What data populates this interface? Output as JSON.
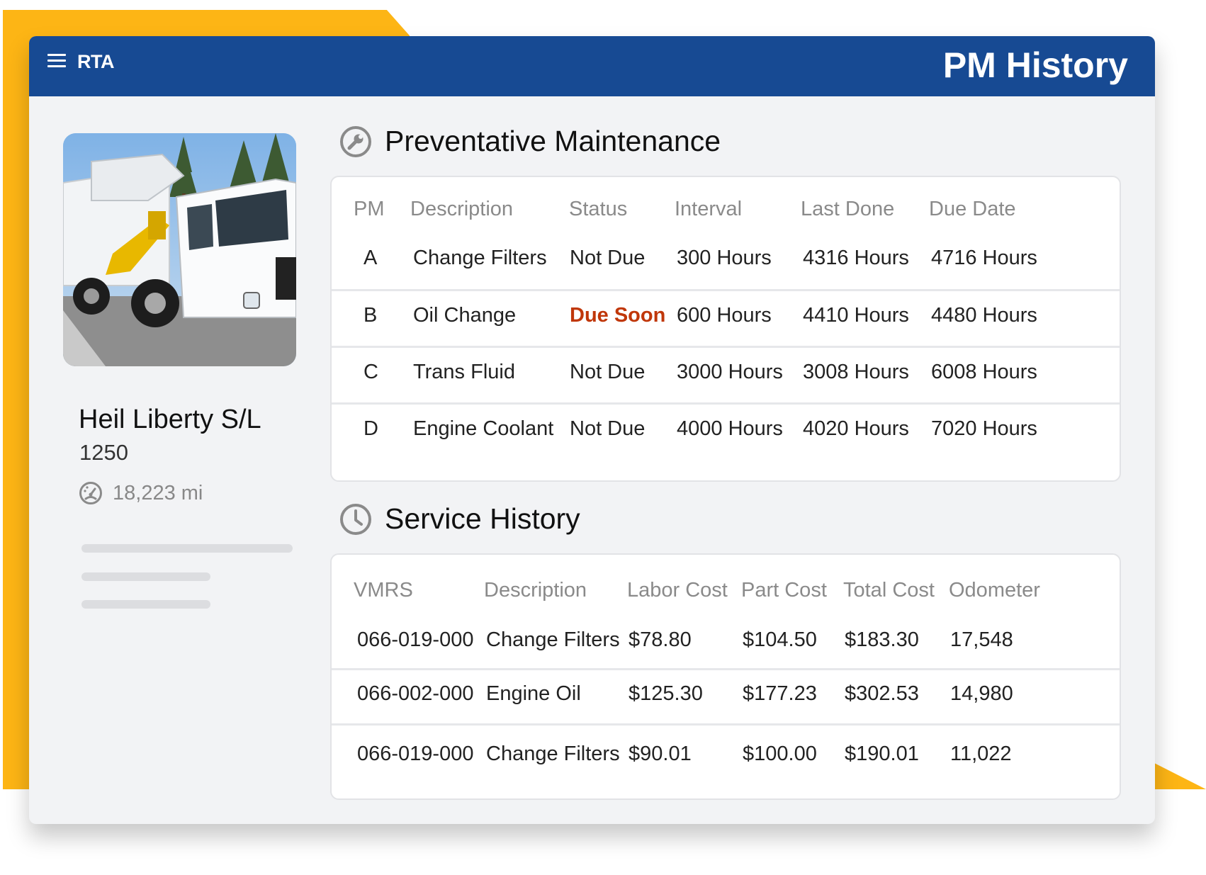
{
  "header": {
    "logo": "RTA",
    "title": "PM History"
  },
  "vehicle": {
    "name": "Heil Liberty S/L",
    "id": "1250",
    "odometer": "18,223 mi"
  },
  "pm": {
    "title": "Preventative Maintenance",
    "columns": [
      "PM",
      "Description",
      "Status",
      "Interval",
      "Last Done",
      "Due Date"
    ],
    "rows": [
      {
        "pm": "A",
        "description": "Change Filters",
        "status": "Not Due",
        "interval": "300 Hours",
        "last_done": "4316 Hours",
        "due_date": "4716 Hours"
      },
      {
        "pm": "B",
        "description": "Oil Change",
        "status": "Due Soon",
        "interval": "600 Hours",
        "last_done": "4410 Hours",
        "due_date": "4480 Hours"
      },
      {
        "pm": "C",
        "description": "Trans Fluid",
        "status": "Not Due",
        "interval": "3000 Hours",
        "last_done": "3008 Hours",
        "due_date": "6008 Hours"
      },
      {
        "pm": "D",
        "description": "Engine Coolant",
        "status": "Not Due",
        "interval": "4000 Hours",
        "last_done": "4020 Hours",
        "due_date": "7020 Hours"
      }
    ]
  },
  "service": {
    "title": "Service History",
    "columns": [
      "VMRS",
      "Description",
      "Labor Cost",
      "Part Cost",
      "Total Cost",
      "Odometer"
    ],
    "rows": [
      {
        "vmrs": "066-019-000",
        "description": "Change Filters",
        "labor": "$78.80",
        "part": "$104.50",
        "total": "$183.30",
        "odometer": "17,548"
      },
      {
        "vmrs": "066-002-000",
        "description": "Engine Oil",
        "labor": "$125.30",
        "part": "$177.23",
        "total": "$302.53",
        "odometer": "14,980"
      },
      {
        "vmrs": "066-019-000",
        "description": "Change Filters",
        "labor": "$90.01",
        "part": "$100.00",
        "total": "$190.01",
        "odometer": "11,022"
      }
    ]
  },
  "colors": {
    "header_bg": "#174A93",
    "accent_yellow": "#FDB515",
    "due_soon": "#C0370A"
  },
  "icons": {
    "menu": "menu-icon",
    "pm_section": "wrench-icon",
    "service_section": "clock-icon",
    "odometer": "speedometer-icon"
  }
}
